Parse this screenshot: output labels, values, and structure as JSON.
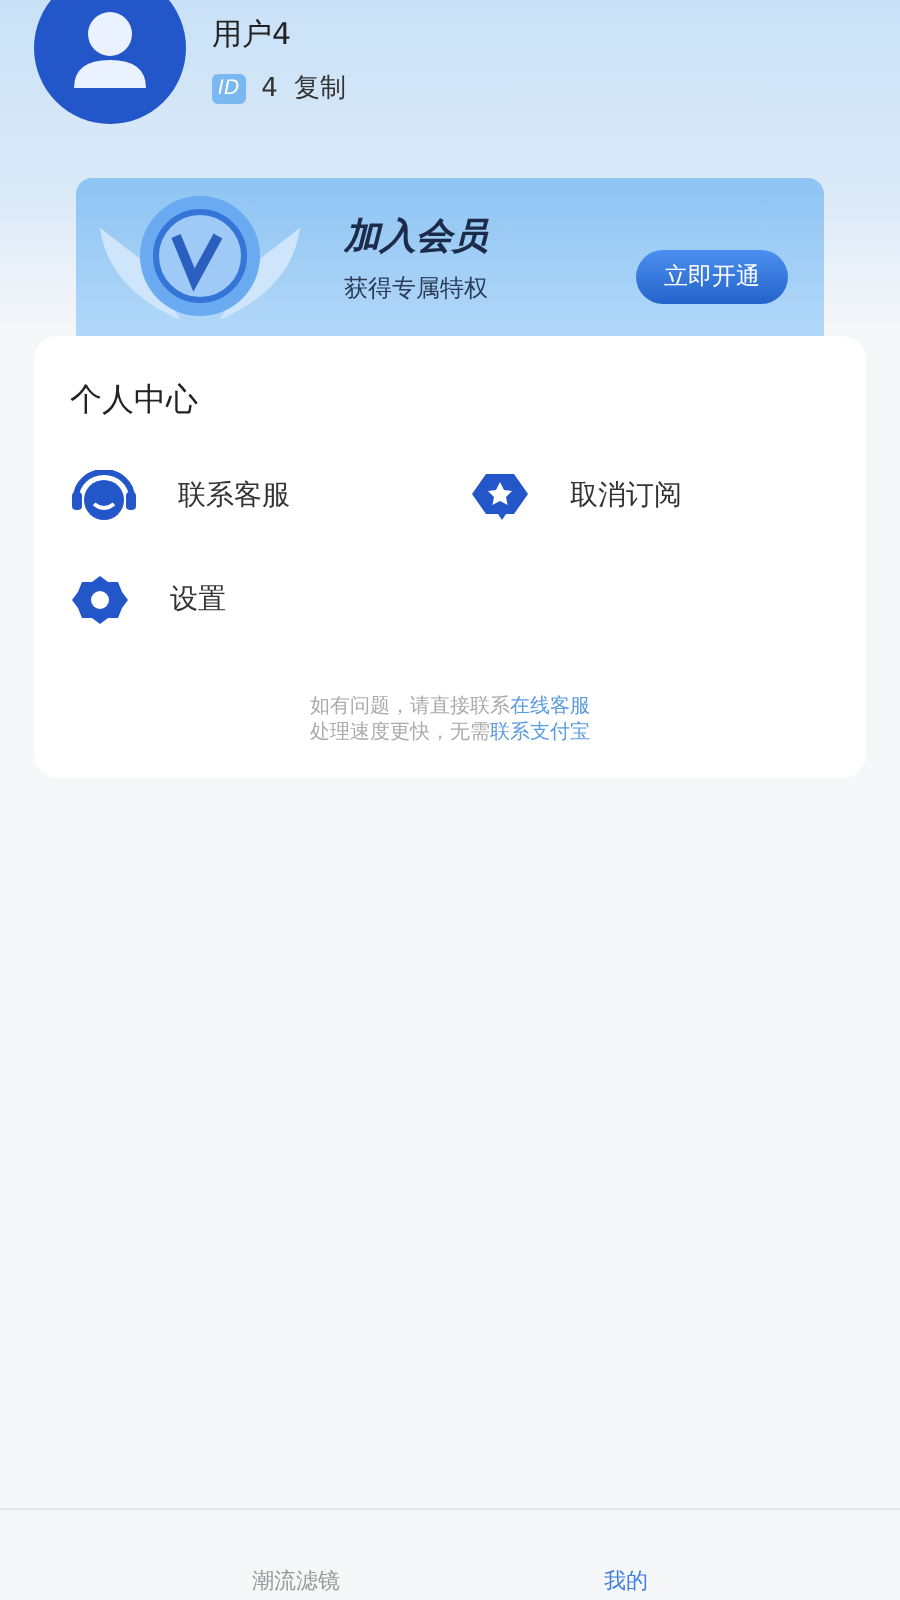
{
  "profile": {
    "name": "用户4",
    "id_badge": "ID",
    "id": "4",
    "copy": "复制"
  },
  "vip_banner": {
    "title": "加入会员",
    "subtitle": "获得专属特权",
    "button": "立即开通"
  },
  "personal_center": {
    "title": "个人中心",
    "items": [
      {
        "kind": "support",
        "label": "联系客服"
      },
      {
        "kind": "unsubscribe",
        "label": "取消订阅"
      },
      {
        "kind": "settings",
        "label": "设置"
      }
    ],
    "note": [
      "如有问题，请直接联系",
      "在线客服",
      "处理速度更快，无需",
      "联系支付宝"
    ]
  },
  "tab_bar": [
    {
      "label": "潮流滤镜",
      "selected": false
    },
    {
      "label": "我的",
      "selected": true
    }
  ]
}
